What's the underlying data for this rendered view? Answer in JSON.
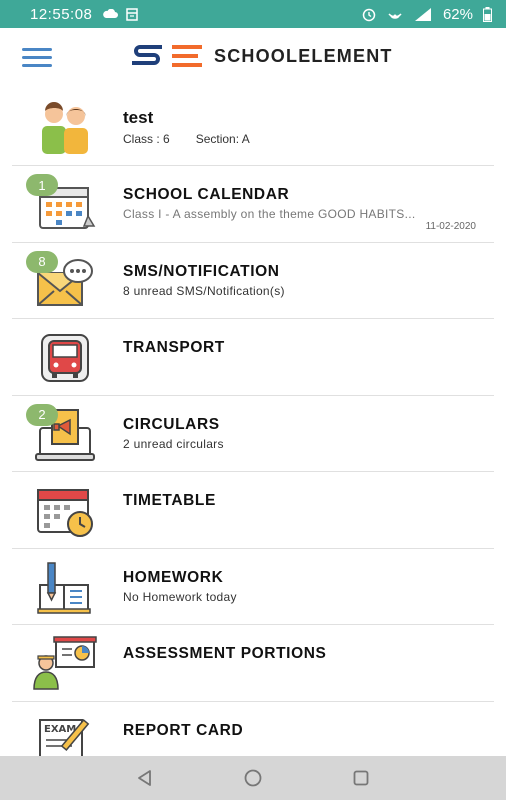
{
  "status_bar": {
    "time": "12:55:08",
    "battery": "62%",
    "network": "4G"
  },
  "app_bar": {
    "brand_name": "SCHOOLELEMENT",
    "logo_text": "SE"
  },
  "user": {
    "name": "test",
    "class_text": "Class : 6",
    "section_text": "Section: A"
  },
  "menu": [
    {
      "title": "SCHOOL CALENDAR",
      "subtitle": "Class I - A assembly on the theme GOOD HABITS...",
      "date": "11-02-2020",
      "badge": "1"
    },
    {
      "title": "SMS/NOTIFICATION",
      "subtitle": "8 unread SMS/Notification(s)",
      "badge": "8"
    },
    {
      "title": "TRANSPORT"
    },
    {
      "title": "CIRCULARS",
      "subtitle": "2 unread circulars",
      "badge": "2"
    },
    {
      "title": "TIMETABLE"
    },
    {
      "title": "HOMEWORK",
      "subtitle": "No Homework today"
    },
    {
      "title": "ASSESSMENT PORTIONS"
    },
    {
      "title": "REPORT CARD"
    }
  ],
  "colors": {
    "status_bar": "#3fa898",
    "badge": "#8db86d",
    "accent_blue": "#4a86c5",
    "logo_orange": "#f26b2b"
  }
}
